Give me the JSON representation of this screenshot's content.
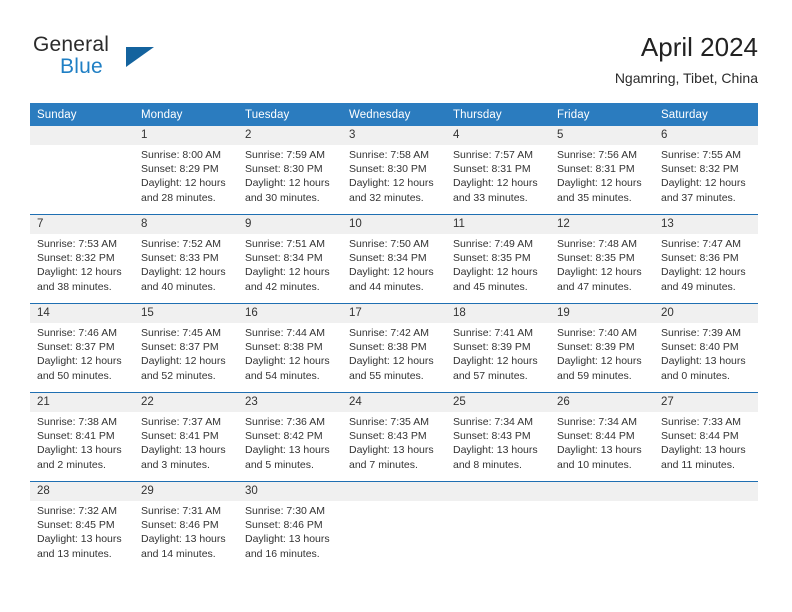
{
  "brand": {
    "word1": "General",
    "word2": "Blue",
    "logo_icon": "triangle-icon",
    "accent": "#1f7fc4",
    "triangle_color": "#14639e"
  },
  "header": {
    "title": "April 2024",
    "subtitle": "Ngamring, Tibet, China"
  },
  "theme": {
    "header_blue": "#2b7cbf",
    "separator_blue": "#1f6fb2",
    "daynum_bg": "#f0f0f0",
    "text": "#333333"
  },
  "calendar": {
    "columns": [
      "Sunday",
      "Monday",
      "Tuesday",
      "Wednesday",
      "Thursday",
      "Friday",
      "Saturday"
    ],
    "weeks": [
      [
        {
          "day": "",
          "lines": []
        },
        {
          "day": "1",
          "lines": [
            "Sunrise: 8:00 AM",
            "Sunset: 8:29 PM",
            "Daylight: 12 hours",
            "and 28 minutes."
          ]
        },
        {
          "day": "2",
          "lines": [
            "Sunrise: 7:59 AM",
            "Sunset: 8:30 PM",
            "Daylight: 12 hours",
            "and 30 minutes."
          ]
        },
        {
          "day": "3",
          "lines": [
            "Sunrise: 7:58 AM",
            "Sunset: 8:30 PM",
            "Daylight: 12 hours",
            "and 32 minutes."
          ]
        },
        {
          "day": "4",
          "lines": [
            "Sunrise: 7:57 AM",
            "Sunset: 8:31 PM",
            "Daylight: 12 hours",
            "and 33 minutes."
          ]
        },
        {
          "day": "5",
          "lines": [
            "Sunrise: 7:56 AM",
            "Sunset: 8:31 PM",
            "Daylight: 12 hours",
            "and 35 minutes."
          ]
        },
        {
          "day": "6",
          "lines": [
            "Sunrise: 7:55 AM",
            "Sunset: 8:32 PM",
            "Daylight: 12 hours",
            "and 37 minutes."
          ]
        }
      ],
      [
        {
          "day": "7",
          "lines": [
            "Sunrise: 7:53 AM",
            "Sunset: 8:32 PM",
            "Daylight: 12 hours",
            "and 38 minutes."
          ]
        },
        {
          "day": "8",
          "lines": [
            "Sunrise: 7:52 AM",
            "Sunset: 8:33 PM",
            "Daylight: 12 hours",
            "and 40 minutes."
          ]
        },
        {
          "day": "9",
          "lines": [
            "Sunrise: 7:51 AM",
            "Sunset: 8:34 PM",
            "Daylight: 12 hours",
            "and 42 minutes."
          ]
        },
        {
          "day": "10",
          "lines": [
            "Sunrise: 7:50 AM",
            "Sunset: 8:34 PM",
            "Daylight: 12 hours",
            "and 44 minutes."
          ]
        },
        {
          "day": "11",
          "lines": [
            "Sunrise: 7:49 AM",
            "Sunset: 8:35 PM",
            "Daylight: 12 hours",
            "and 45 minutes."
          ]
        },
        {
          "day": "12",
          "lines": [
            "Sunrise: 7:48 AM",
            "Sunset: 8:35 PM",
            "Daylight: 12 hours",
            "and 47 minutes."
          ]
        },
        {
          "day": "13",
          "lines": [
            "Sunrise: 7:47 AM",
            "Sunset: 8:36 PM",
            "Daylight: 12 hours",
            "and 49 minutes."
          ]
        }
      ],
      [
        {
          "day": "14",
          "lines": [
            "Sunrise: 7:46 AM",
            "Sunset: 8:37 PM",
            "Daylight: 12 hours",
            "and 50 minutes."
          ]
        },
        {
          "day": "15",
          "lines": [
            "Sunrise: 7:45 AM",
            "Sunset: 8:37 PM",
            "Daylight: 12 hours",
            "and 52 minutes."
          ]
        },
        {
          "day": "16",
          "lines": [
            "Sunrise: 7:44 AM",
            "Sunset: 8:38 PM",
            "Daylight: 12 hours",
            "and 54 minutes."
          ]
        },
        {
          "day": "17",
          "lines": [
            "Sunrise: 7:42 AM",
            "Sunset: 8:38 PM",
            "Daylight: 12 hours",
            "and 55 minutes."
          ]
        },
        {
          "day": "18",
          "lines": [
            "Sunrise: 7:41 AM",
            "Sunset: 8:39 PM",
            "Daylight: 12 hours",
            "and 57 minutes."
          ]
        },
        {
          "day": "19",
          "lines": [
            "Sunrise: 7:40 AM",
            "Sunset: 8:39 PM",
            "Daylight: 12 hours",
            "and 59 minutes."
          ]
        },
        {
          "day": "20",
          "lines": [
            "Sunrise: 7:39 AM",
            "Sunset: 8:40 PM",
            "Daylight: 13 hours",
            "and 0 minutes."
          ]
        }
      ],
      [
        {
          "day": "21",
          "lines": [
            "Sunrise: 7:38 AM",
            "Sunset: 8:41 PM",
            "Daylight: 13 hours",
            "and 2 minutes."
          ]
        },
        {
          "day": "22",
          "lines": [
            "Sunrise: 7:37 AM",
            "Sunset: 8:41 PM",
            "Daylight: 13 hours",
            "and 3 minutes."
          ]
        },
        {
          "day": "23",
          "lines": [
            "Sunrise: 7:36 AM",
            "Sunset: 8:42 PM",
            "Daylight: 13 hours",
            "and 5 minutes."
          ]
        },
        {
          "day": "24",
          "lines": [
            "Sunrise: 7:35 AM",
            "Sunset: 8:43 PM",
            "Daylight: 13 hours",
            "and 7 minutes."
          ]
        },
        {
          "day": "25",
          "lines": [
            "Sunrise: 7:34 AM",
            "Sunset: 8:43 PM",
            "Daylight: 13 hours",
            "and 8 minutes."
          ]
        },
        {
          "day": "26",
          "lines": [
            "Sunrise: 7:34 AM",
            "Sunset: 8:44 PM",
            "Daylight: 13 hours",
            "and 10 minutes."
          ]
        },
        {
          "day": "27",
          "lines": [
            "Sunrise: 7:33 AM",
            "Sunset: 8:44 PM",
            "Daylight: 13 hours",
            "and 11 minutes."
          ]
        }
      ],
      [
        {
          "day": "28",
          "lines": [
            "Sunrise: 7:32 AM",
            "Sunset: 8:45 PM",
            "Daylight: 13 hours",
            "and 13 minutes."
          ]
        },
        {
          "day": "29",
          "lines": [
            "Sunrise: 7:31 AM",
            "Sunset: 8:46 PM",
            "Daylight: 13 hours",
            "and 14 minutes."
          ]
        },
        {
          "day": "30",
          "lines": [
            "Sunrise: 7:30 AM",
            "Sunset: 8:46 PM",
            "Daylight: 13 hours",
            "and 16 minutes."
          ]
        },
        {
          "day": "",
          "lines": []
        },
        {
          "day": "",
          "lines": []
        },
        {
          "day": "",
          "lines": []
        },
        {
          "day": "",
          "lines": []
        }
      ]
    ]
  }
}
